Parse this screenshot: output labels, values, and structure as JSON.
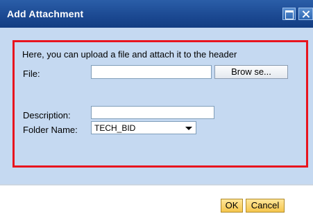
{
  "dialog": {
    "title": "Add Attachment",
    "title_icons": [
      "maximize-icon",
      "close-icon"
    ]
  },
  "upload": {
    "intro_text": "Here, you can upload a file and attach it to the header",
    "file_label": "File:",
    "file_value": "",
    "browse_label": "Brow se...",
    "description_label": "Description:",
    "description_value": "",
    "folder_label": "Folder Name:",
    "folder_value": "TECH_BID"
  },
  "actions": {
    "ok_label": "OK",
    "cancel_label": "Cancel"
  },
  "colors": {
    "title_bar": "#1c4a93",
    "panel_bg": "#c5d9f1",
    "highlight_border": "#e8141e",
    "action_button": "#f5c64d"
  }
}
